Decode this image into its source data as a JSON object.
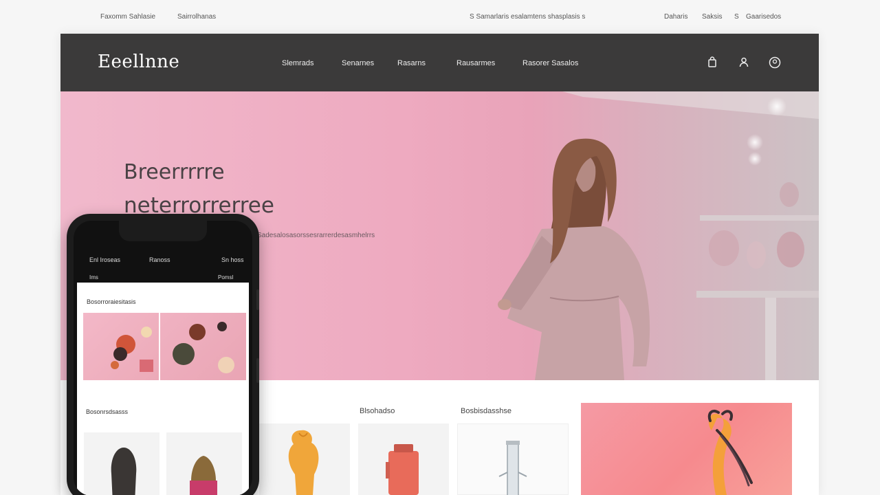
{
  "utility_bar": {
    "left_links": [
      "Faxomm Sahlasie",
      "Sairrolhanas"
    ],
    "center_text": "S Samarlaris esalamtens  shasplasis s",
    "right_links": [
      "Daharis",
      "Saksis",
      "S",
      "Gaarisedos"
    ]
  },
  "header": {
    "logo": "Eeellnne",
    "nav_items": [
      "Slemrads",
      "Senarnes",
      "Rasarns",
      "Rausarmes",
      "Rasorer Sasalos"
    ],
    "icons": [
      "bag-icon",
      "user-icon",
      "account-icon"
    ]
  },
  "hero": {
    "title_line1": "Breerrrrre",
    "title_line2": "neterrorrerree",
    "subtitle": "Sadesalosasorssesrarrerdesasmhelrrs"
  },
  "sections": {
    "label_a": "Blsohadso",
    "label_b": "Bosbisdasshse"
  },
  "phone": {
    "status_left": "Enl Iroseas",
    "status_center": "Ranoss",
    "status_right": "Sn hoss",
    "sub_left": "Ims",
    "sub_right": "Pomsl",
    "section_title": "Bosorroraiesitasis",
    "section_title_2": "Bosonrsdsasss"
  },
  "colors": {
    "nav_bg": "#3b3a3a",
    "hero_pink": "#eeaac0",
    "promo_coral": "#f68a8e"
  }
}
